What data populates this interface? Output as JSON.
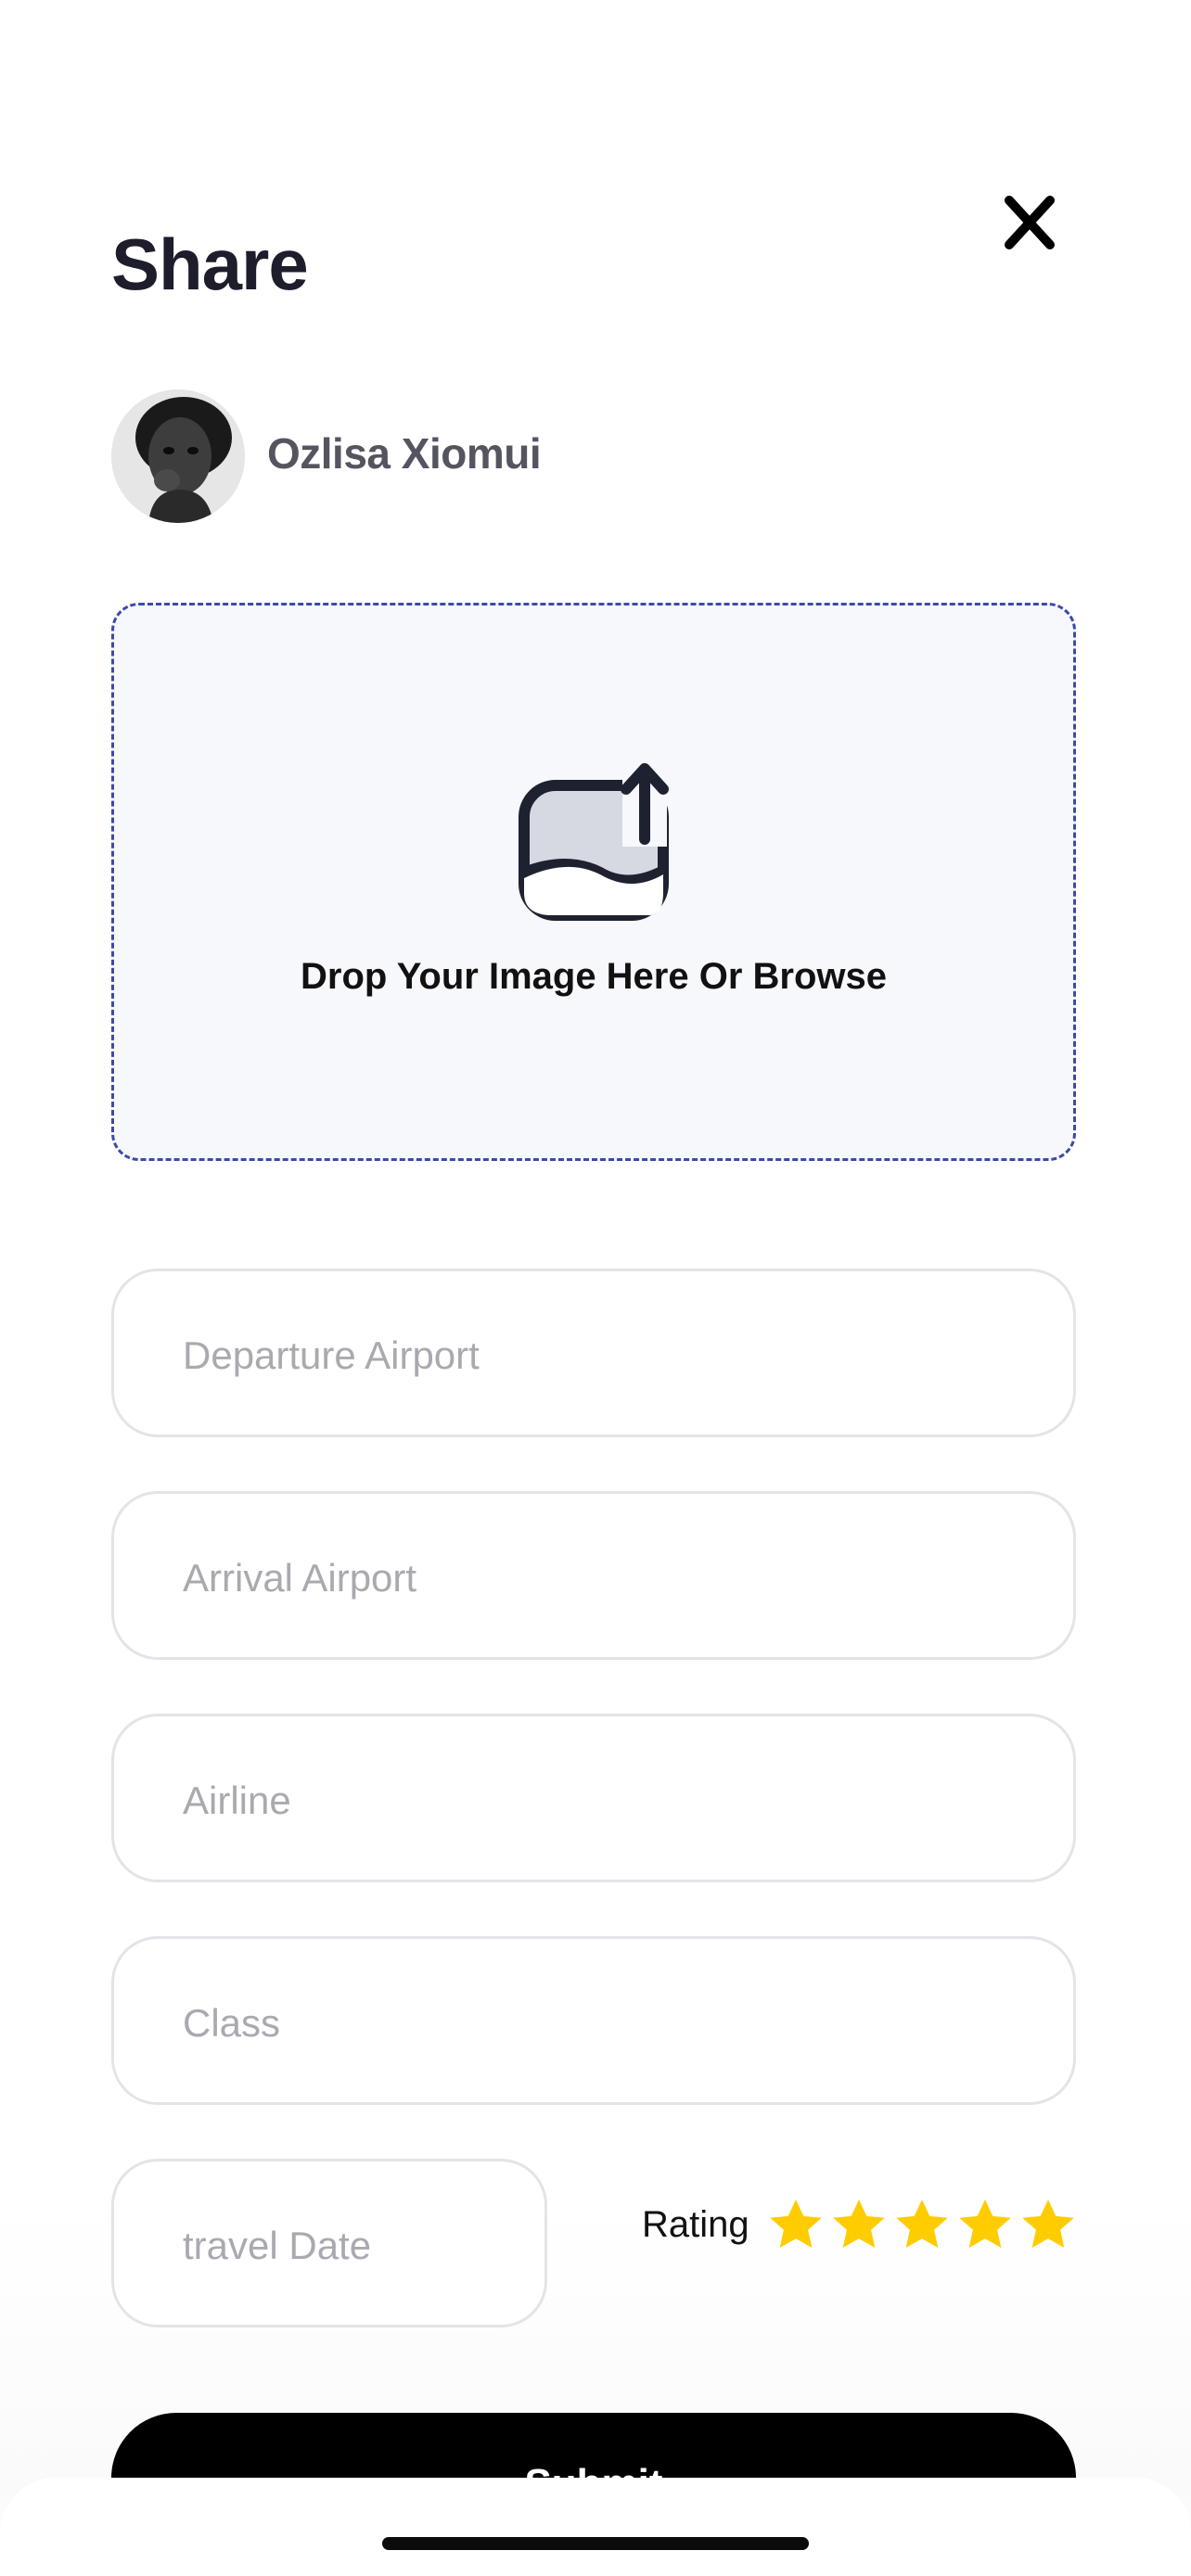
{
  "header": {
    "title": "Share",
    "close_icon": "close-icon"
  },
  "user": {
    "name": "Ozlisa Xiomui",
    "avatar_icon": "avatar"
  },
  "upload": {
    "icon": "image-upload-icon",
    "label": "Drop Your Image Here Or Browse"
  },
  "form": {
    "departure_placeholder": "Departure Airport",
    "arrival_placeholder": "Arrival Airport",
    "airline_placeholder": "Airline",
    "class_placeholder": "Class",
    "date_placeholder": "travel Date"
  },
  "rating": {
    "label": "Rating",
    "value": 5,
    "max": 5,
    "star_color": "#ffcc00"
  },
  "submit": {
    "label": "Submit"
  },
  "colors": {
    "title": "#1d1d2c",
    "dropzone_border": "#3c4aa8",
    "dropzone_bg": "#f7f8fc",
    "button": "#000000"
  }
}
